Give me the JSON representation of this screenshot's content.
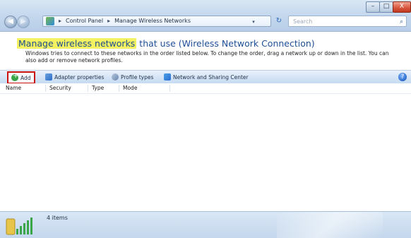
{
  "window": {
    "controls": {
      "minimize": "–",
      "maximize": "□",
      "close": "X"
    }
  },
  "address_bar": {
    "breadcrumbs": [
      "Control Panel",
      "Manage Wireless Networks"
    ],
    "separator": "▸",
    "dropdown": "▾"
  },
  "search": {
    "placeholder": "Search"
  },
  "header": {
    "title_highlight": "Manage wireless networks",
    "title_rest": " that use (Wireless Network Connection)",
    "description": "Windows tries to connect to these networks in the order listed below. To change the order, drag a network up or down in the list. You can also add or remove network profiles."
  },
  "toolbar": {
    "items": [
      {
        "label": "Add",
        "icon": "plus-icon"
      },
      {
        "label": "Adapter properties",
        "icon": "adapter-icon"
      },
      {
        "label": "Profile types",
        "icon": "profile-icon"
      },
      {
        "label": "Network and Sharing Center",
        "icon": "network-icon"
      }
    ],
    "help_label": "?"
  },
  "columns": [
    "Name",
    "Security",
    "Type",
    "Mode"
  ],
  "status": {
    "count_text": "4 items"
  },
  "colors": {
    "title_blue": "#1f4f99",
    "highlight_yellow": "#f4f261",
    "add_border_red": "#cc1111",
    "chrome_blue": "#c6d9ee"
  }
}
